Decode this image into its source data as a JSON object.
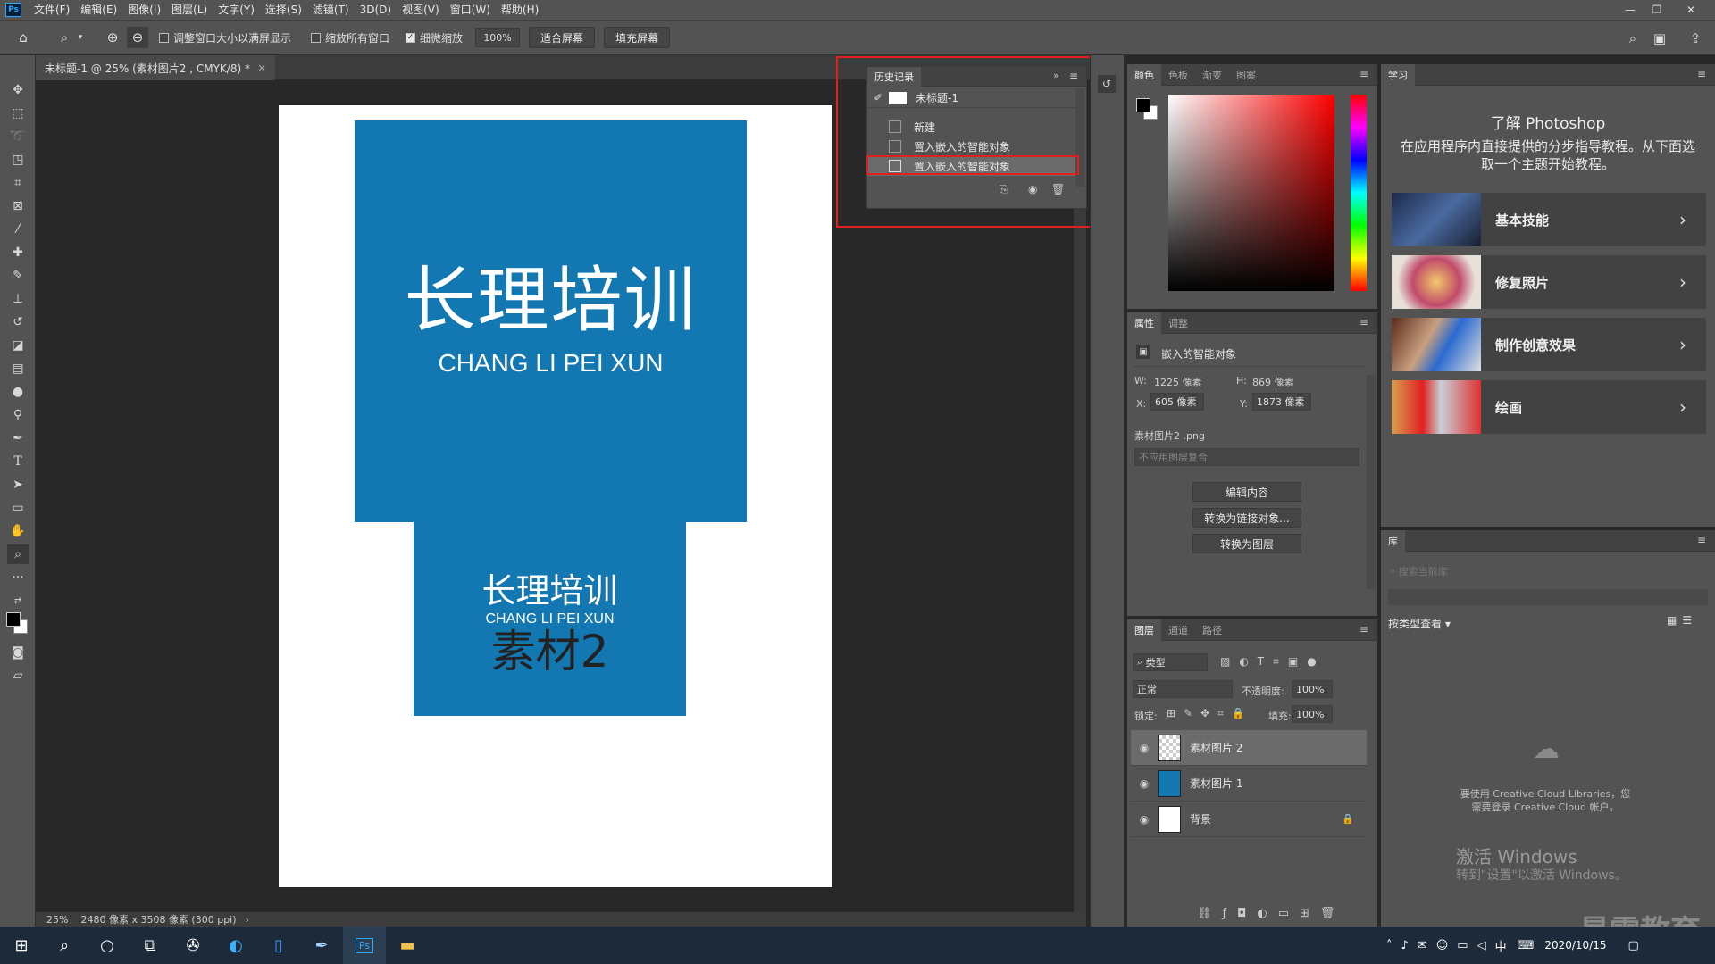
{
  "app": {
    "logo": "Ps"
  },
  "menu": [
    "文件(F)",
    "编辑(E)",
    "图像(I)",
    "图层(L)",
    "文字(Y)",
    "选择(S)",
    "滤镜(T)",
    "3D(D)",
    "视图(V)",
    "窗口(W)",
    "帮助(H)"
  ],
  "options_bar": {
    "resize_windows_label": "调整窗口大小以满屏显示",
    "zoom_all_label": "缩放所有窗口",
    "scrubby_zoom_label": "细微缩放",
    "zoom_value": "100%",
    "fit_screen": "适合屏幕",
    "fill_screen": "填充屏幕"
  },
  "document": {
    "tab_title": "未标题-1 @ 25% (素材图片2 , CMYK/8) *",
    "zoom": "25%",
    "info": "2480 像素 x 3508 像素 (300 ppi)",
    "big_card": {
      "title": "长理培训",
      "subtitle": "CHANG LI PEI XUN"
    },
    "small_card": {
      "title": "长理培训",
      "subtitle": "CHANG LI PEI XUN",
      "label": "素材2"
    }
  },
  "history": {
    "tab": "历史记录",
    "snapshot": "未标题-1",
    "items": [
      "新建",
      "置入嵌入的智能对象",
      "置入嵌入的智能对象"
    ]
  },
  "color_panel": {
    "tabs": [
      "颜色",
      "色板",
      "渐变",
      "图案"
    ]
  },
  "properties": {
    "tabs": [
      "属性",
      "调整"
    ],
    "type": "嵌入的智能对象",
    "w_label": "W:",
    "w": "1225 像素",
    "h_label": "H:",
    "h": "869 像素",
    "x_label": "X:",
    "x": "605 像素",
    "y_label": "Y:",
    "y": "1873 像素",
    "file": "素材图片2 .png",
    "comp_placeholder": "不应用图层复合",
    "btn_edit": "编辑内容",
    "btn_link": "转换为链接对象...",
    "btn_layer": "转换为图层"
  },
  "layers": {
    "tabs": [
      "图层",
      "通道",
      "路径"
    ],
    "filter": "类型",
    "blend": "正常",
    "opacity_label": "不透明度:",
    "opacity": "100%",
    "lock_label": "锁定:",
    "fill_label": "填充:",
    "fill": "100%",
    "rows": [
      "素材图片 2",
      "素材图片 1",
      "背景"
    ]
  },
  "learn": {
    "tab": "学习",
    "title": "了解 Photoshop",
    "desc": "在应用程序内直接提供的分步指导教程。从下面选取一个主题开始教程。",
    "cards": [
      "基本技能",
      "修复照片",
      "制作创意效果",
      "绘画"
    ]
  },
  "library": {
    "tab": "库",
    "search_placeholder": "搜索当前库",
    "view_by": "按类型查看",
    "cc_msg": "要使用 Creative Cloud Libraries，您需要登录 Creative Cloud 帐户。"
  },
  "watermark": {
    "line1": "激活 Windows",
    "line2": "转到\"设置\"以激活 Windows。",
    "brand": "最需教育"
  },
  "taskbar": {
    "ime": "中",
    "date": "2020/10/15"
  },
  "colors": {
    "accent_blue": "#1377b1",
    "highlight_red": "#e02020"
  }
}
